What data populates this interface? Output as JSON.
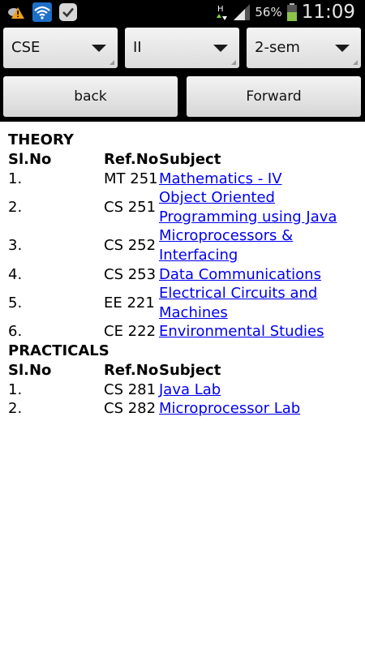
{
  "status_bar": {
    "battery_percent": "56%",
    "time": "11:09",
    "network_type": "H"
  },
  "selectors": {
    "department": "CSE",
    "year": "II",
    "semester": "2-sem"
  },
  "buttons": {
    "back": "back",
    "forward": "Forward"
  },
  "theory": {
    "title": "THEORY",
    "headers": {
      "sl": "Sl.No",
      "ref": "Ref.No",
      "subject": "Subject"
    },
    "rows": [
      {
        "sl": "1.",
        "ref": "MT 251",
        "subject": "Mathematics - IV"
      },
      {
        "sl": "2.",
        "ref": "CS 251",
        "subject": "Object Oriented Programming using Java"
      },
      {
        "sl": "3.",
        "ref": "CS 252",
        "subject": "Microprocessors & Interfacing"
      },
      {
        "sl": "4.",
        "ref": "CS 253",
        "subject": "Data Communications"
      },
      {
        "sl": "5.",
        "ref": "EE 221",
        "subject": "Electrical Circuits and Machines"
      },
      {
        "sl": "6.",
        "ref": "CE 222",
        "subject": "Environmental Studies"
      }
    ]
  },
  "practicals": {
    "title": "PRACTICALS",
    "headers": {
      "sl": "Sl.No",
      "ref": "Ref.No",
      "subject": "Subject"
    },
    "rows": [
      {
        "sl": "1.",
        "ref": "CS 281",
        "subject": "Java Lab"
      },
      {
        "sl": "2.",
        "ref": "CS 282",
        "subject": "Microprocessor Lab"
      }
    ]
  },
  "colors": {
    "link": "#0000ee",
    "bar_background": "#000000",
    "battery_fill": "#8bc34a"
  }
}
